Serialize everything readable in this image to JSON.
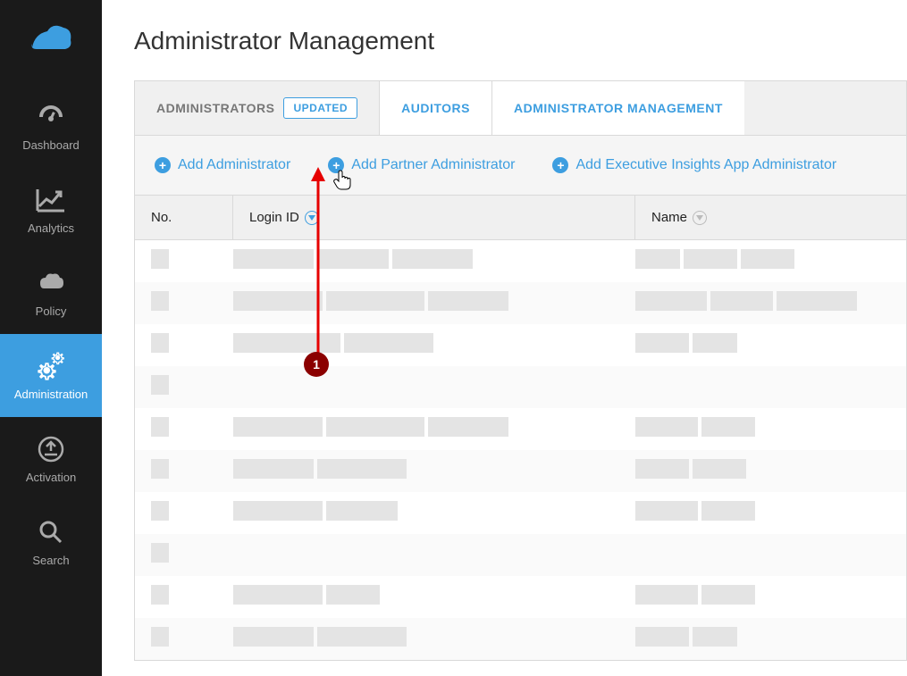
{
  "sidebar": {
    "items": [
      {
        "label": "Dashboard"
      },
      {
        "label": "Analytics"
      },
      {
        "label": "Policy"
      },
      {
        "label": "Administration"
      },
      {
        "label": "Activation"
      },
      {
        "label": "Search"
      }
    ]
  },
  "page": {
    "title": "Administrator Management"
  },
  "tabs": {
    "administrators": "ADMINISTRATORS",
    "updated_badge": "UPDATED",
    "auditors": "AUDITORS",
    "admin_mgmt": "ADMINISTRATOR MANAGEMENT"
  },
  "actions": {
    "add_admin": "Add Administrator",
    "add_partner": "Add Partner Administrator",
    "add_exec": "Add Executive Insights App Administrator"
  },
  "table": {
    "headers": {
      "no": "No.",
      "login": "Login ID",
      "name": "Name"
    }
  },
  "annotation": {
    "step": "1"
  }
}
